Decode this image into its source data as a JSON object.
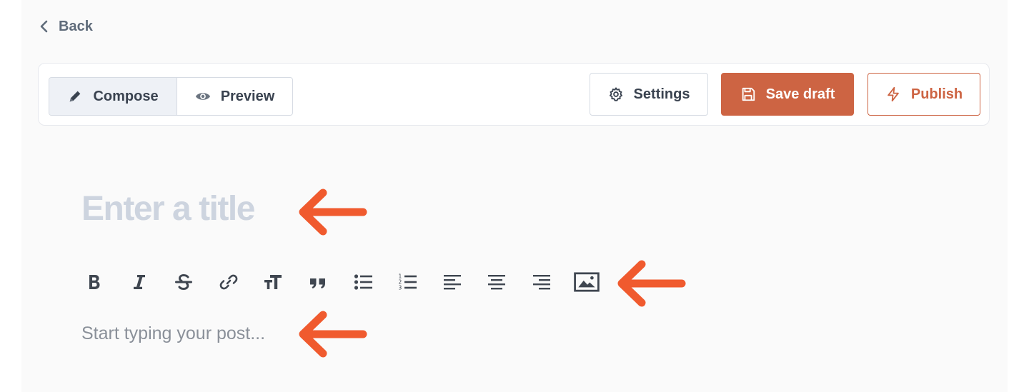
{
  "nav": {
    "back_label": "Back"
  },
  "mode_tabs": [
    {
      "label": "Compose",
      "icon": "pencil-icon",
      "active": true
    },
    {
      "label": "Preview",
      "icon": "eye-icon",
      "active": false
    }
  ],
  "actions": {
    "settings_label": "Settings",
    "save_draft_label": "Save draft",
    "publish_label": "Publish"
  },
  "editor": {
    "title_placeholder": "Enter a title",
    "body_placeholder": "Start typing your post..."
  },
  "format_toolbar": [
    "bold-icon",
    "italic-icon",
    "strikethrough-icon",
    "link-icon",
    "text-size-icon",
    "quote-icon",
    "bullet-list-icon",
    "numbered-list-icon",
    "align-left-icon",
    "align-center-icon",
    "align-right-icon",
    "image-icon"
  ],
  "colors": {
    "accent": "#cd6443",
    "annotation_arrow": "#f05a2e",
    "placeholder_title": "#cdd4df",
    "text_dark": "#3a4350"
  }
}
